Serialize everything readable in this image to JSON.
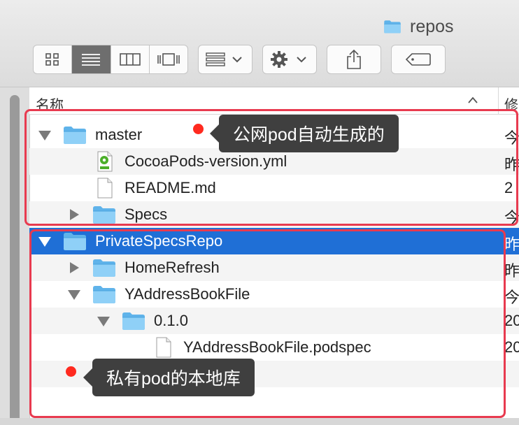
{
  "window": {
    "title": "repos"
  },
  "toolbar": {
    "view_icons": [
      "grid-view-icon",
      "list-view-icon",
      "column-view-icon",
      "gallery-view-icon"
    ],
    "group_icon": "group-icon",
    "action_icon": "gear-icon",
    "share_icon": "share-icon",
    "tag_icon": "tag-icon"
  },
  "columns": {
    "name": "名称",
    "modified": "修"
  },
  "rows": [
    {
      "label": "master",
      "date": "今"
    },
    {
      "label": "CocoaPods-version.yml",
      "date": "昨"
    },
    {
      "label": "README.md",
      "date": "2"
    },
    {
      "label": "Specs",
      "date": "今"
    },
    {
      "label": "PrivateSpecsRepo",
      "date": "昨"
    },
    {
      "label": "HomeRefresh",
      "date": "昨"
    },
    {
      "label": "YAddressBookFile",
      "date": "今"
    },
    {
      "label": "0.1.0",
      "date": "20"
    },
    {
      "label": "YAddressBookFile.podspec",
      "date": "20"
    }
  ],
  "annotations": {
    "public_tip": "公网pod自动生成的",
    "private_tip": "私有pod的本地库"
  },
  "colors": {
    "selection": "#1f6fd6",
    "annotation_box": "#e83a4f",
    "dot": "#ff2a1f",
    "folder": "#5fb3ea"
  }
}
